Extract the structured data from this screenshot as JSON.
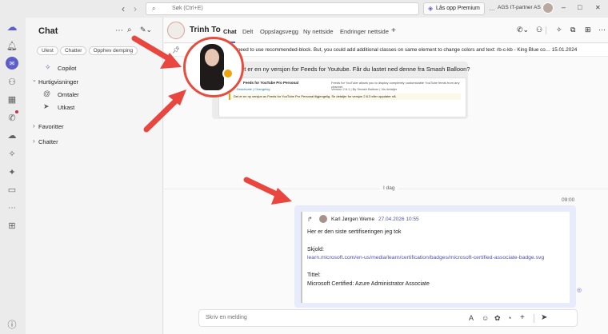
{
  "topbar": {
    "search_placeholder": "Søk (Ctrl+E)",
    "premium": "Lås opp Premium",
    "org": "AGS IT-partner AS",
    "minimize": "–",
    "maximize": "□",
    "close": "✕",
    "back": "‹",
    "forward": "›",
    "more": "…"
  },
  "rail": {
    "icons": [
      "teams",
      "activity",
      "chat",
      "teams-groups",
      "calendar",
      "calls",
      "onedrive",
      "copilot",
      "apps-lines",
      "camera",
      "more",
      "add"
    ]
  },
  "left": {
    "title": "Chat",
    "filters": [
      "Ulest",
      "Chatter",
      "Opphev demping"
    ],
    "copilot": "Copilot",
    "quickviews": "Hurtigvisninger",
    "mentions": "Omtaler",
    "drafts": "Utkast",
    "favorites": "Favoritter",
    "chats": "Chatter"
  },
  "header": {
    "name": "Trinh To",
    "tabs": [
      "Chat",
      "Delt",
      "Oppslagsvegg",
      "Ny nettside",
      "Endringer nettside"
    ],
    "add": "+"
  },
  "pinned": {
    "text": "…, you need to use recommended-block. But, you could add additional classes on same element to change colors and text: rb-c-kb - King Blue co… 15.01.2024"
  },
  "old_msg": {
    "title": "…er, det er en ny versjon for Feeds for Youtube. Får du lastet ned denne fra Smash Balloon?",
    "plugin": "Feeds for YouTube Pro Personal",
    "desc": "Feeds for YouTube allows you to display completely customizable YouTube feeds from any channel.",
    "version": "Version 2.6.1 | By Smash Balloon | Vis detaljer",
    "left_small": "…Deactivate | Changelog",
    "notice": "Det er en ny versjon av Feeds for YouTube Pro Personal tilgjengelig. Se detaljer for versjon 2.6.3 eller oppdater nå."
  },
  "date_divider": "I dag",
  "time": "09:00",
  "forward": {
    "author": "Karl Jørgen Weme",
    "date": "27.04.2026 10:55",
    "line1": "Her er den siste sertifiseringen jeg tok",
    "shield_label": "Skjold:",
    "link": "learn.microsoft.com/en-us/media/learn/certification/badges/microsoft-certified-associate-badge.svg",
    "title_label": "Tittel:",
    "title_value": "Microsoft Certified: Azure Administrator Associate"
  },
  "compose": {
    "placeholder": "Skriv en melding"
  },
  "colors": {
    "accent": "#5b5fc7",
    "arrow": "#e8463f",
    "ring": "#e84c3d"
  }
}
